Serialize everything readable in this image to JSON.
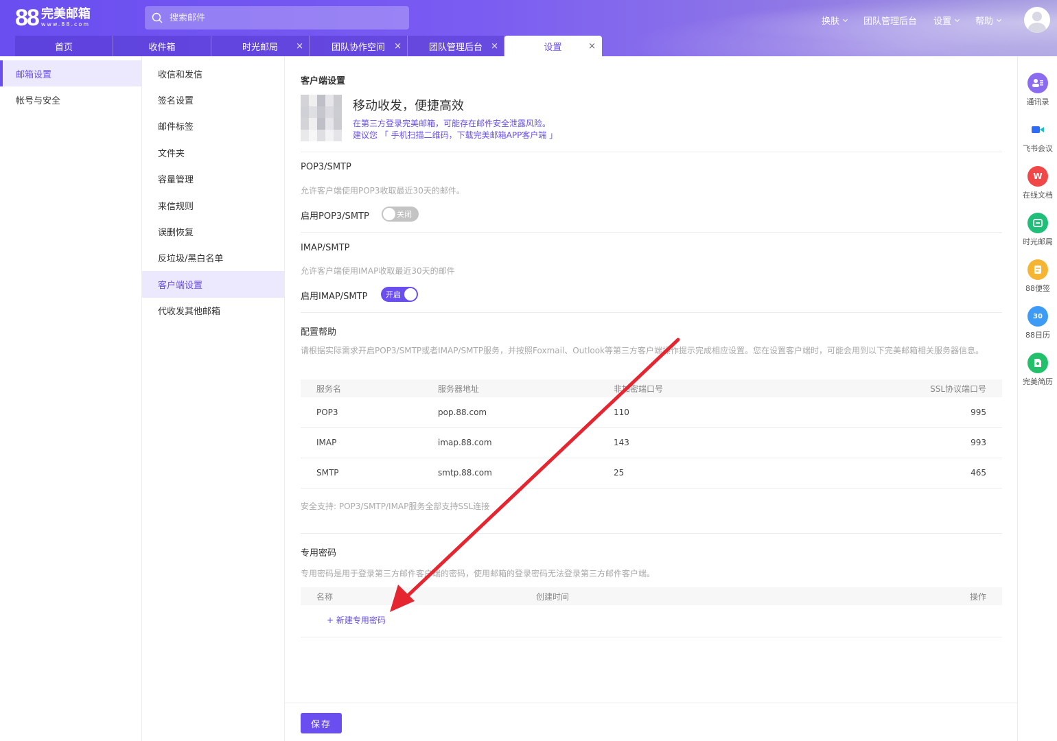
{
  "header": {
    "logo_number": "88",
    "logo_name": "完美邮箱",
    "logo_url": "www.88.com",
    "search_placeholder": "搜索邮件",
    "nav": [
      "换肤",
      "团队管理后台",
      "设置",
      "帮助"
    ]
  },
  "tabs": [
    {
      "label": "首页",
      "closable": false
    },
    {
      "label": "收件箱",
      "closable": false
    },
    {
      "label": "时光邮局",
      "closable": true
    },
    {
      "label": "团队协作空间",
      "closable": true
    },
    {
      "label": "团队管理后台",
      "closable": true
    },
    {
      "label": "设置",
      "closable": true,
      "active": true
    }
  ],
  "sidebar1": [
    "邮箱设置",
    "帐号与安全"
  ],
  "sidebar2": [
    "收信和发信",
    "签名设置",
    "邮件标签",
    "文件夹",
    "容量管理",
    "来信规则",
    "误删恢复",
    "反垃圾/黑白名单",
    "客户端设置",
    "代收发其他邮箱"
  ],
  "main": {
    "title": "客户端设置",
    "promo_title": "移动收发，便捷高效",
    "promo_line1": "在第三方登录完美邮箱，可能存在邮件安全泄露风险。",
    "promo_line2": "建议您 「 手机扫描二维码，下载完美邮箱APP客户端 」",
    "pop3": {
      "title": "POP3/SMTP",
      "hint": "允许客户端使用POP3收取最近30天的邮件。",
      "label": "启用POP3/SMTP",
      "toggle": "关闭"
    },
    "imap": {
      "title": "IMAP/SMTP",
      "hint": "允许客户端使用IMAP收取最近30天的邮件",
      "label": "启用IMAP/SMTP",
      "toggle": "开启"
    },
    "config": {
      "title": "配置帮助",
      "desc": "请根据实际需求开启POP3/SMTP或者IMAP/SMTP服务，并按照Foxmail、Outlook等第三方客户端操作提示完成相应设置。您在设置客户端时，可能会用到以下完美邮箱相关服务器信息。",
      "columns": [
        "服务名",
        "服务器地址",
        "非加密端口号",
        "SSL协议端口号"
      ],
      "rows": [
        [
          "POP3",
          "pop.88.com",
          "110",
          "995"
        ],
        [
          "IMAP",
          "imap.88.com",
          "143",
          "993"
        ],
        [
          "SMTP",
          "smtp.88.com",
          "25",
          "465"
        ]
      ],
      "ssl_note": "安全支持: POP3/SMTP/IMAP服务全部支持SSL连接"
    },
    "password": {
      "title": "专用密码",
      "desc": "专用密码是用于登录第三方邮件客户端的密码，使用邮箱的登录密码无法登录第三方邮件客户端。",
      "columns": [
        "名称",
        "创建时间",
        "操作"
      ],
      "new_label": "+ 新建专用密码"
    },
    "save_label": "保存"
  },
  "rail": [
    {
      "label": "通讯录",
      "icon": "contacts-icon",
      "color": "#8b6cf0"
    },
    {
      "label": "飞书会议",
      "icon": "video-meeting-icon",
      "color": "#2f6cf5"
    },
    {
      "label": "在线文档",
      "icon": "wps-doc-icon",
      "color": "#f04848"
    },
    {
      "label": "时光邮局",
      "icon": "time-mail-icon",
      "color": "#1fbf7a"
    },
    {
      "label": "88便签",
      "icon": "note-icon",
      "color": "#f5b533"
    },
    {
      "label": "88日历",
      "icon": "calendar-icon",
      "color": "#3d9bf5"
    },
    {
      "label": "完美简历",
      "icon": "resume-icon",
      "color": "#22c06a"
    }
  ],
  "colors": {
    "accent": "#6a4ef0",
    "arrow": "#e52631"
  }
}
